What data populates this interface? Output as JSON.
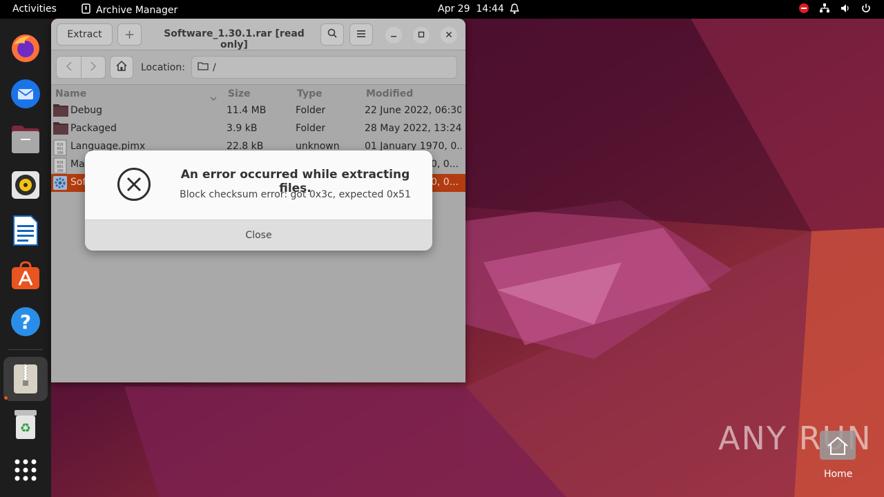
{
  "topbar": {
    "activities": "Activities",
    "app_name": "Archive Manager",
    "date": "Apr 29",
    "time": "14:44"
  },
  "dock": {
    "items": [
      "Firefox",
      "Thunderbird",
      "Files",
      "Rhythmbox",
      "LibreOffice Writer",
      "Ubuntu Software",
      "Help",
      "Archive Manager",
      "Trash",
      "Show Applications"
    ]
  },
  "window": {
    "extract_label": "Extract",
    "add_label": "+",
    "title": "Software_1.30.1.rar [read only]",
    "location_label": "Location:",
    "location_value": "/",
    "columns": {
      "name": "Name",
      "size": "Size",
      "type": "Type",
      "modified": "Modified"
    },
    "rows": [
      {
        "name": "Debug",
        "size": "11.4 MB",
        "type": "Folder",
        "modified": "22 June 2022, 06:30",
        "icon": "folder-icon"
      },
      {
        "name": "Packaged",
        "size": "3.9 kB",
        "type": "Folder",
        "modified": "28 May 2022, 13:24",
        "icon": "folder-icon"
      },
      {
        "name": "Language.pimx",
        "size": "22.8 kB",
        "type": "unknown",
        "modified": "01 January 1970, 0...",
        "icon": "binary-file-icon"
      },
      {
        "name": "Ma",
        "size": "",
        "type": "",
        "modified": "0, 0...",
        "icon": "binary-file-icon"
      },
      {
        "name": "Sof",
        "size": "",
        "type": "",
        "modified": "0, 0...",
        "icon": "executable-gear-icon",
        "selected": true
      }
    ]
  },
  "dialog": {
    "title": "An error occurred while extracting files.",
    "message": "Block checksum error: got 0x3c, expected 0x51",
    "close_label": "Close"
  },
  "desktop": {
    "watermark": "ANY RUN",
    "home_label": "Home"
  },
  "colors": {
    "selection": "#b23c10",
    "accent": "#e95420"
  }
}
